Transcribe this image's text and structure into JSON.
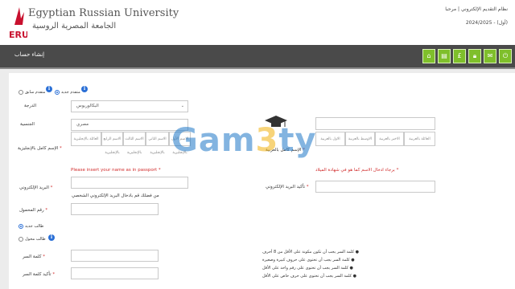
{
  "header": {
    "university_en": "Egyptian Russian University",
    "university_ar": "الجامعة المصرية الروسية",
    "logo_text": "ERU",
    "system_line": "نظام التقديم الإلكتروني | مرحبا",
    "year_line": "(أول) - 2024/2025"
  },
  "nav": {
    "title": "إنشاء حساب",
    "icons": [
      "home-icon",
      "document-icon",
      "money-icon",
      "lock-icon",
      "mail-icon",
      "power-icon"
    ]
  },
  "form": {
    "applicant_type": {
      "previous_label": "متقدم سابق",
      "new_label": "متقدم جديد",
      "selected": "new"
    },
    "degree": {
      "label": "الدرجة",
      "value": "البكالوريوس"
    },
    "nationality": {
      "label": "الجنسية",
      "value": "مصري"
    },
    "english_name": {
      "label": "الإسم كامل بالإنجليزية",
      "cells": [
        "الاسم الرابع بالإنجليزية",
        "الاسم الثالث بالإنجليزية",
        "الاسم الثاني بالإنجليزية",
        "الاسم الأول بالإنجليزية"
      ],
      "cell_first": "العائلة بالإنجليزية",
      "error": "Please insert your name as in passport"
    },
    "arabic_name": {
      "label": "الإسم كامل بالعربية",
      "cells": [
        "العائلة بالعربية",
        "الاخير بالعربية",
        "الاوسط بالعربية",
        "الاول بالعربية"
      ],
      "error": "برجاء ادخال الاسم كما هو في شهادة الميلاد"
    },
    "email": {
      "label": "البريد الإلكتروني",
      "hint": "من فضلك قم بادخال البريد الإلكتروني الشخصي"
    },
    "confirm_email": {
      "label": "تأكيد البريد الإلكتروني"
    },
    "mobile": {
      "label": "رقم المحمول"
    },
    "student_type": {
      "new_label": "طالب جديد",
      "transfer_label": "طالب محول",
      "selected": "new"
    },
    "password": {
      "label": "كلمة السر"
    },
    "confirm_password": {
      "label": "تأكيد كلمة السر"
    },
    "password_rules": [
      "كلمة السر يجب أن تكون مكونة على الأقل من 8 أحرف",
      "كلمة السر يجب أن تحتوى على حروف كبيرة وصغيرة",
      "كلمة السر يجب أن تحتوى على رقم واحد على الأقل",
      "كلمة السر يجب أن تحتوى على حرف خاص على الأقل"
    ],
    "required_mark": "*",
    "info_mark": "i"
  },
  "watermark": {
    "text_a": "Gam",
    "text_b": "3",
    "text_c": "ty"
  },
  "colors": {
    "nav_bg": "#4a4a4a",
    "icon_green": "#7fbf2b",
    "error": "#d12c2c",
    "info_blue": "#2a6fd6",
    "logo_red": "#c8102e"
  }
}
